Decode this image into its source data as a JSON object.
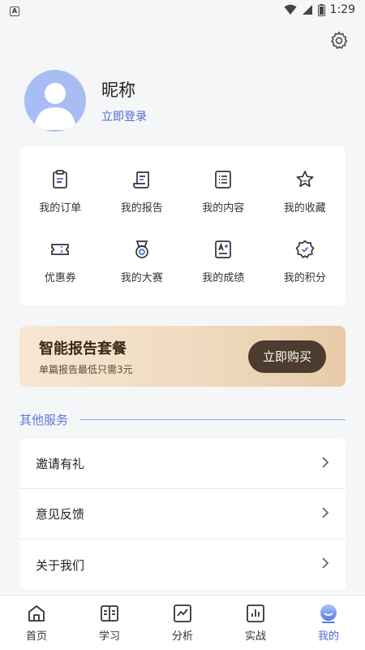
{
  "status_bar": {
    "left_badge": "A",
    "time": "1:29"
  },
  "profile": {
    "nickname": "昵称",
    "login_link": "立即登录"
  },
  "grid": [
    {
      "label": "我的订单",
      "icon": "clipboard-icon"
    },
    {
      "label": "我的报告",
      "icon": "scroll-report-icon"
    },
    {
      "label": "我的内容",
      "icon": "list-icon"
    },
    {
      "label": "我的收藏",
      "icon": "star-icon"
    },
    {
      "label": "优惠券",
      "icon": "ticket-icon"
    },
    {
      "label": "我的大赛",
      "icon": "medal-icon"
    },
    {
      "label": "我的成绩",
      "icon": "grade-icon"
    },
    {
      "label": "我的积分",
      "icon": "points-badge-icon"
    }
  ],
  "promo": {
    "title": "智能报告套餐",
    "subtitle": "单篇报告最低只需3元",
    "button": "立即购买"
  },
  "section": {
    "title": "其他服务"
  },
  "menu": [
    {
      "label": "邀请有礼"
    },
    {
      "label": "意见反馈"
    },
    {
      "label": "关于我们"
    }
  ],
  "tabs": [
    {
      "label": "首页",
      "icon": "home-icon"
    },
    {
      "label": "学习",
      "icon": "book-icon"
    },
    {
      "label": "分析",
      "icon": "analysis-icon"
    },
    {
      "label": "实战",
      "icon": "bar-chart-icon"
    },
    {
      "label": "我的",
      "icon": "profile-icon",
      "active": true
    }
  ],
  "colors": {
    "accent": "#4a6ad1",
    "promo_button": "#4c3b2e",
    "avatar_bg": "#a9bdf5"
  }
}
